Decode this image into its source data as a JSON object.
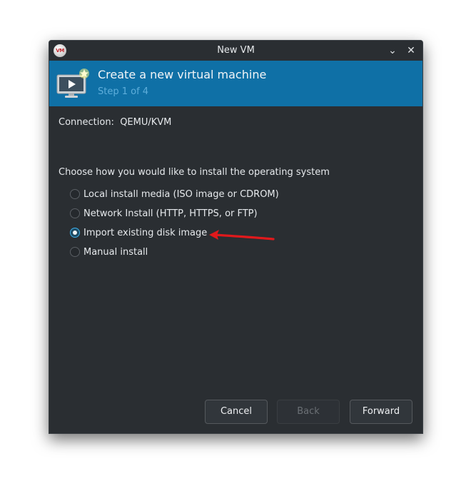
{
  "window": {
    "title": "New VM",
    "app_icon_text": "VM",
    "controls": {
      "minimize_glyph": "⌄",
      "close_glyph": "✕"
    }
  },
  "banner": {
    "title": "Create a new virtual machine",
    "step": "Step 1 of 4",
    "icon": "monitor-play-icon"
  },
  "connection": {
    "label": "Connection:",
    "value": "QEMU/KVM"
  },
  "install": {
    "prompt": "Choose how you would like to install the operating system",
    "options": [
      {
        "label": "Local install media (ISO image or CDROM)",
        "checked": false
      },
      {
        "label": "Network Install (HTTP, HTTPS, or FTP)",
        "checked": false
      },
      {
        "label": "Import existing disk image",
        "checked": true
      },
      {
        "label": "Manual install",
        "checked": false
      }
    ]
  },
  "annotation": {
    "arrow_color": "#e0191c",
    "points_to": "Import existing disk image"
  },
  "buttons": {
    "cancel": "Cancel",
    "back": "Back",
    "forward": "Forward"
  },
  "colors": {
    "banner": "#0f70a6",
    "background": "#2a2e32",
    "accent": "#3daee9"
  }
}
